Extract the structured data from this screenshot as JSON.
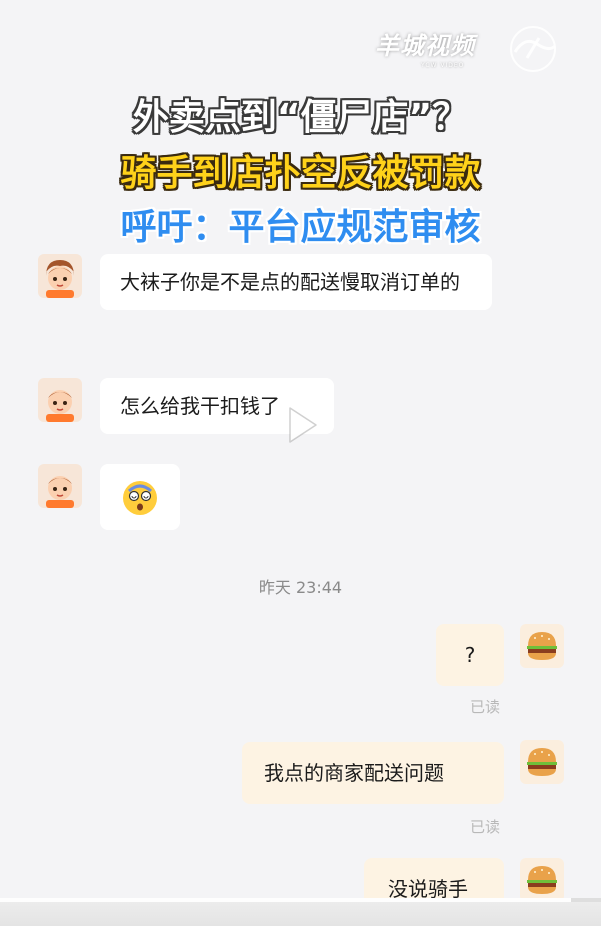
{
  "watermark": {
    "brand": "羊城视频",
    "sub": "YCW VIDEO"
  },
  "headline": {
    "line1": "外卖点到“僵尸店”？",
    "line2": "骑手到店扑空反被罚款",
    "line3": "呼吁：平台应规范审核"
  },
  "chat": {
    "messages": [
      {
        "from": "other",
        "text": "大袜子你是不是点的配送慢取消订单的"
      },
      {
        "from": "other",
        "text": "怎么给我干扣钱了"
      },
      {
        "from": "other",
        "emoji": "dizzy-face-emoji"
      },
      {
        "from": "me",
        "text": "?"
      },
      {
        "from": "me",
        "text": "我点的商家配送问题"
      },
      {
        "from": "me",
        "text": "没说骑手"
      }
    ],
    "timestamp": "昨天 23:44",
    "read_label": "已读"
  },
  "player": {
    "progress": 0.95
  },
  "colors": {
    "headline_yellow": "#ffd21a",
    "headline_blue": "#2f8df0",
    "my_bubble": "#fdf3e3",
    "background": "#f4f4f6"
  }
}
